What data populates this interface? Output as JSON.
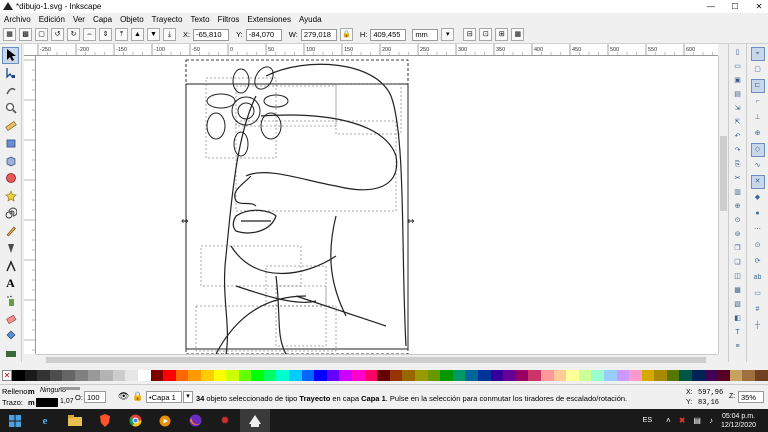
{
  "window": {
    "title": "*dibujo-1.svg - Inkscape",
    "minimize": "—",
    "maximize": "☐",
    "close": "✕"
  },
  "menu": [
    "Archivo",
    "Edición",
    "Ver",
    "Capa",
    "Objeto",
    "Trayecto",
    "Texto",
    "Filtros",
    "Extensiones",
    "Ayuda"
  ],
  "toolbar": {
    "x_label": "X:",
    "x_value": "-65,810",
    "y_label": "Y:",
    "y_value": "-84,070",
    "w_label": "W:",
    "w_value": "279,018",
    "h_label": "H:",
    "h_value": "409,455",
    "unit": "mm"
  },
  "ruler_labels": [
    "-250",
    "-200",
    "-150",
    "-100",
    "-50",
    "0",
    "50",
    "100",
    "150",
    "200",
    "250",
    "300",
    "350",
    "400",
    "450",
    "500",
    "550",
    "600"
  ],
  "status": {
    "fill_label": "Relleno:",
    "fill_value": "m",
    "fill_note": "Ninguno",
    "stroke_label": "Trazo:",
    "stroke_value": "m",
    "stroke_width": "1,07",
    "opacity_label": "O:",
    "opacity_value": "100",
    "layer": "•Capa 1",
    "message_count": "34",
    "message_1": " objeto seleccionado de tipo ",
    "message_type": "Trayecto",
    "message_2": " en capa ",
    "message_layer": "Capa 1",
    "message_3": ". Pulse en la selección para conmutar los tiradores de escalado/rotación.",
    "cursor_x_label": "X:",
    "cursor_x": "597,96",
    "cursor_y_label": "Y:",
    "cursor_y": "83,16",
    "zoom_label": "Z:",
    "zoom_value": "35%"
  },
  "taskbar": {
    "lang": "ES",
    "time": "05:04 p.m.",
    "date": "12/12/2020"
  },
  "colors": {
    "accent": "#6a8fbf",
    "taskbar": "#1a1a1a"
  },
  "palette": [
    "#000000",
    "#1a1a1a",
    "#333333",
    "#4d4d4d",
    "#666666",
    "#808080",
    "#999999",
    "#b3b3b3",
    "#cccccc",
    "#e6e6e6",
    "#ffffff",
    "#800000",
    "#ff0000",
    "#ff6600",
    "#ff9900",
    "#ffcc00",
    "#ffff00",
    "#ccff00",
    "#66ff00",
    "#00ff00",
    "#00ff66",
    "#00ffcc",
    "#00ccff",
    "#0066ff",
    "#0000ff",
    "#6600ff",
    "#cc00ff",
    "#ff00cc",
    "#ff0066",
    "#660000",
    "#993300",
    "#996600",
    "#999900",
    "#669900",
    "#009900",
    "#009966",
    "#006699",
    "#003399",
    "#330099",
    "#660099",
    "#990066",
    "#cc3366",
    "#ff9999",
    "#ffcc99",
    "#ffff99",
    "#ccff99",
    "#99ffcc",
    "#99ccff",
    "#cc99ff",
    "#ff99cc",
    "#d4aa00",
    "#aa8800",
    "#557700",
    "#005544",
    "#002255",
    "#440055",
    "#550022",
    "#c8a060",
    "#a07040",
    "#704020"
  ]
}
